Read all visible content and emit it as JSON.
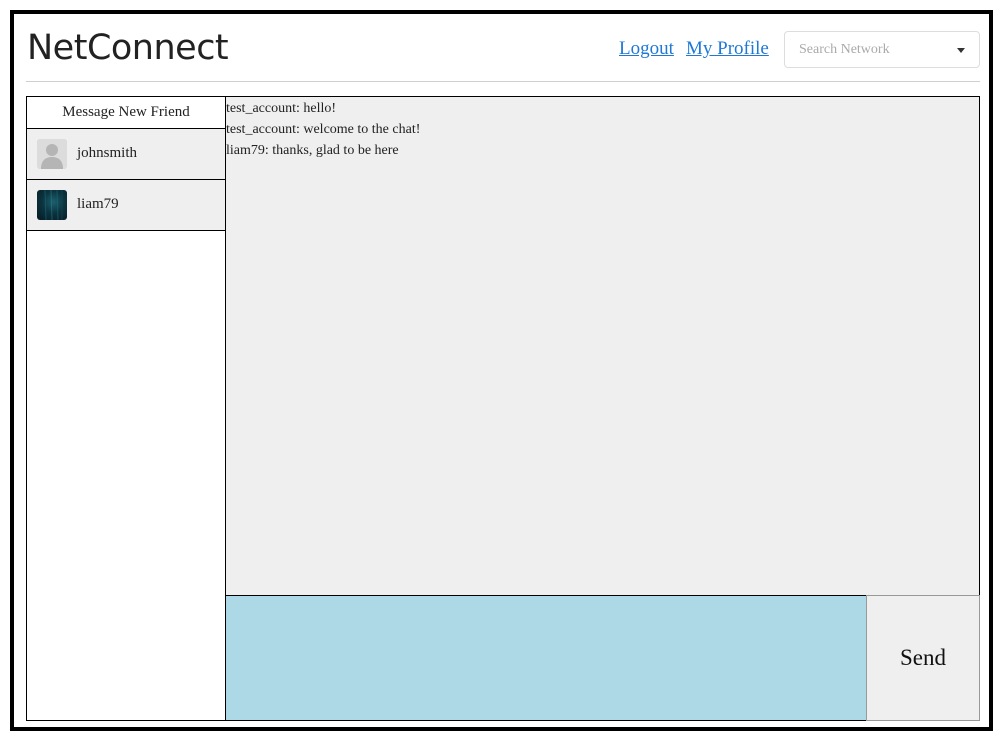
{
  "header": {
    "brand": "NetConnect",
    "logout_label": "Logout",
    "profile_label": "My Profile",
    "search_placeholder": "Search Network",
    "search_value": ""
  },
  "sidebar": {
    "new_friend_label": "Message New Friend",
    "friends": [
      {
        "name": "johnsmith",
        "avatar_icon": "default-user-avatar"
      },
      {
        "name": "liam79",
        "avatar_icon": "photo-avatar"
      }
    ]
  },
  "chat": {
    "messages": [
      "test_account: hello!",
      "test_account: welcome to the chat!",
      "liam79: thanks, glad to be here"
    ],
    "composer_value": "",
    "send_label": "Send"
  },
  "colors": {
    "link": "#1f78d6",
    "chat_background": "#efefef",
    "composer_background": "#add8e6"
  }
}
